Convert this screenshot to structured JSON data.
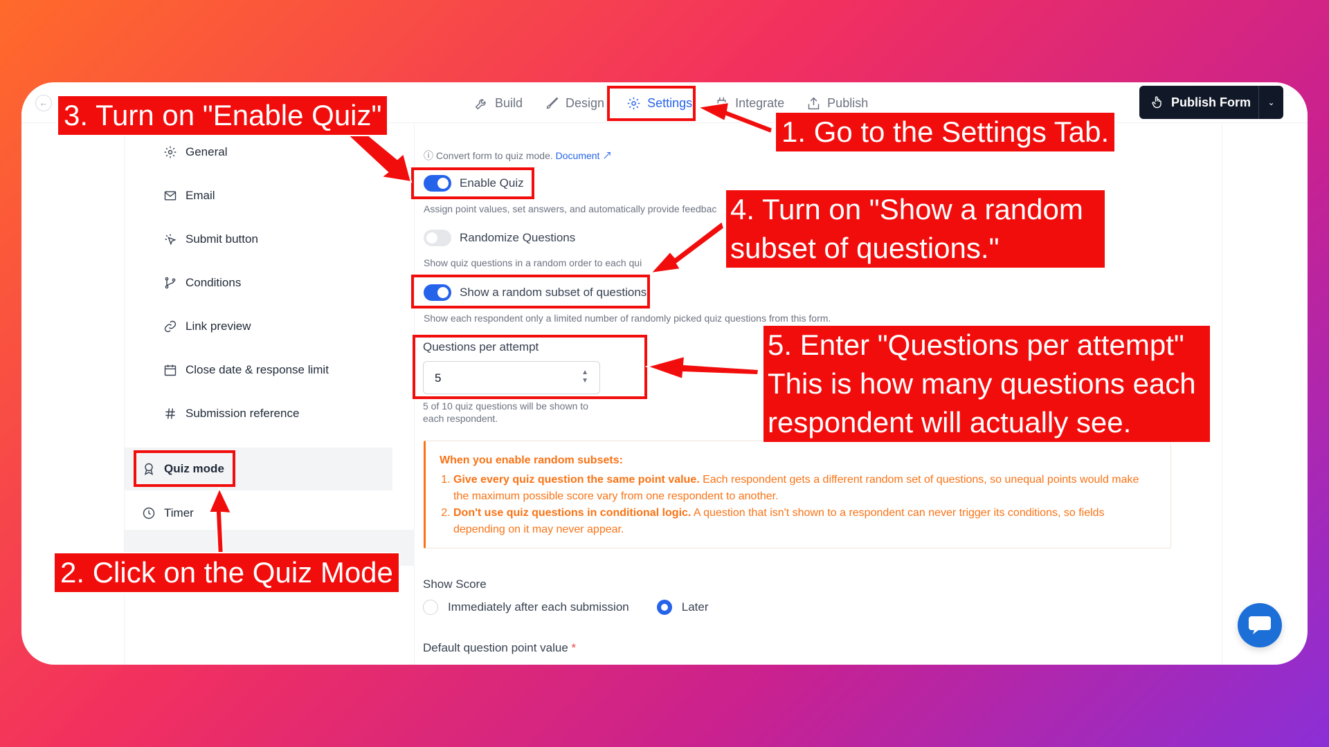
{
  "topbar": {
    "tabs": [
      {
        "label": "Build",
        "icon": "wrench-icon"
      },
      {
        "label": "Design",
        "icon": "brush-icon"
      },
      {
        "label": "Settings",
        "icon": "gear-icon",
        "active": true
      },
      {
        "label": "Integrate",
        "icon": "plug-icon"
      },
      {
        "label": "Publish",
        "icon": "upload-icon"
      }
    ],
    "publish_button": "Publish Form"
  },
  "sidebar": {
    "items": [
      {
        "label": "General",
        "icon": "gear-icon"
      },
      {
        "label": "Email",
        "icon": "mail-icon"
      },
      {
        "label": "Submit button",
        "icon": "click-icon"
      },
      {
        "label": "Conditions",
        "icon": "branch-icon"
      },
      {
        "label": "Link preview",
        "icon": "link-icon"
      },
      {
        "label": "Close date & response limit",
        "icon": "calendar-icon"
      },
      {
        "label": "Submission reference",
        "icon": "hash-icon"
      },
      {
        "label": "Quiz mode",
        "icon": "award-icon",
        "active": true
      },
      {
        "label": "Timer",
        "icon": "clock-icon"
      }
    ]
  },
  "quiz": {
    "convert_hint": "Convert form to quiz mode.",
    "document_link": "Document",
    "enable_quiz_label": "Enable Quiz",
    "enable_quiz_on": true,
    "enable_quiz_desc": "Assign point values, set answers, and automatically provide feedbac",
    "randomize_label": "Randomize Questions",
    "randomize_on": false,
    "randomize_desc": "Show quiz questions in a random order to each qui",
    "subset_label": "Show a random subset of questions",
    "subset_on": true,
    "subset_desc": "Show each respondent only a limited number of randomly picked quiz questions from this form.",
    "per_attempt_label": "Questions per attempt",
    "per_attempt_value": "5",
    "per_attempt_hint_1": "5 of 10 quiz questions will be shown to",
    "per_attempt_hint_2": "each respondent.",
    "notice_title": "When you enable random subsets:",
    "notice_1_bold": "Give every quiz question the same point value.",
    "notice_1_text": " Each respondent gets a different random set of questions, so unequal points would make the maximum possible score vary from one respondent to another.",
    "notice_2_bold": "Don't use quiz questions in conditional logic.",
    "notice_2_text": " A question that isn't shown to a respondent can never trigger its conditions, so fields depending on it may never appear.",
    "show_score_label": "Show Score",
    "score_option_1": "Immediately after each submission",
    "score_option_2": "Later",
    "score_selected": "Later",
    "default_point_label": "Default question point value",
    "required_mark": "*"
  },
  "annotations": {
    "step1": "1. Go to the Settings Tab.",
    "step2": "2. Click on the Quiz Mode",
    "step3": "3. Turn on \"Enable Quiz\"",
    "step4_line1": "4. Turn on \"Show a random",
    "step4_line2": "subset of questions.\"",
    "step5_line1": "5. Enter \"Questions per attempt\"",
    "step5_line2": "This is how many questions each",
    "step5_line3": "respondent will actually see."
  },
  "colors": {
    "accent": "#2563eb",
    "annotation_red": "#f20d0d",
    "notice_orange": "#f97316",
    "publish_bg": "#111827"
  }
}
